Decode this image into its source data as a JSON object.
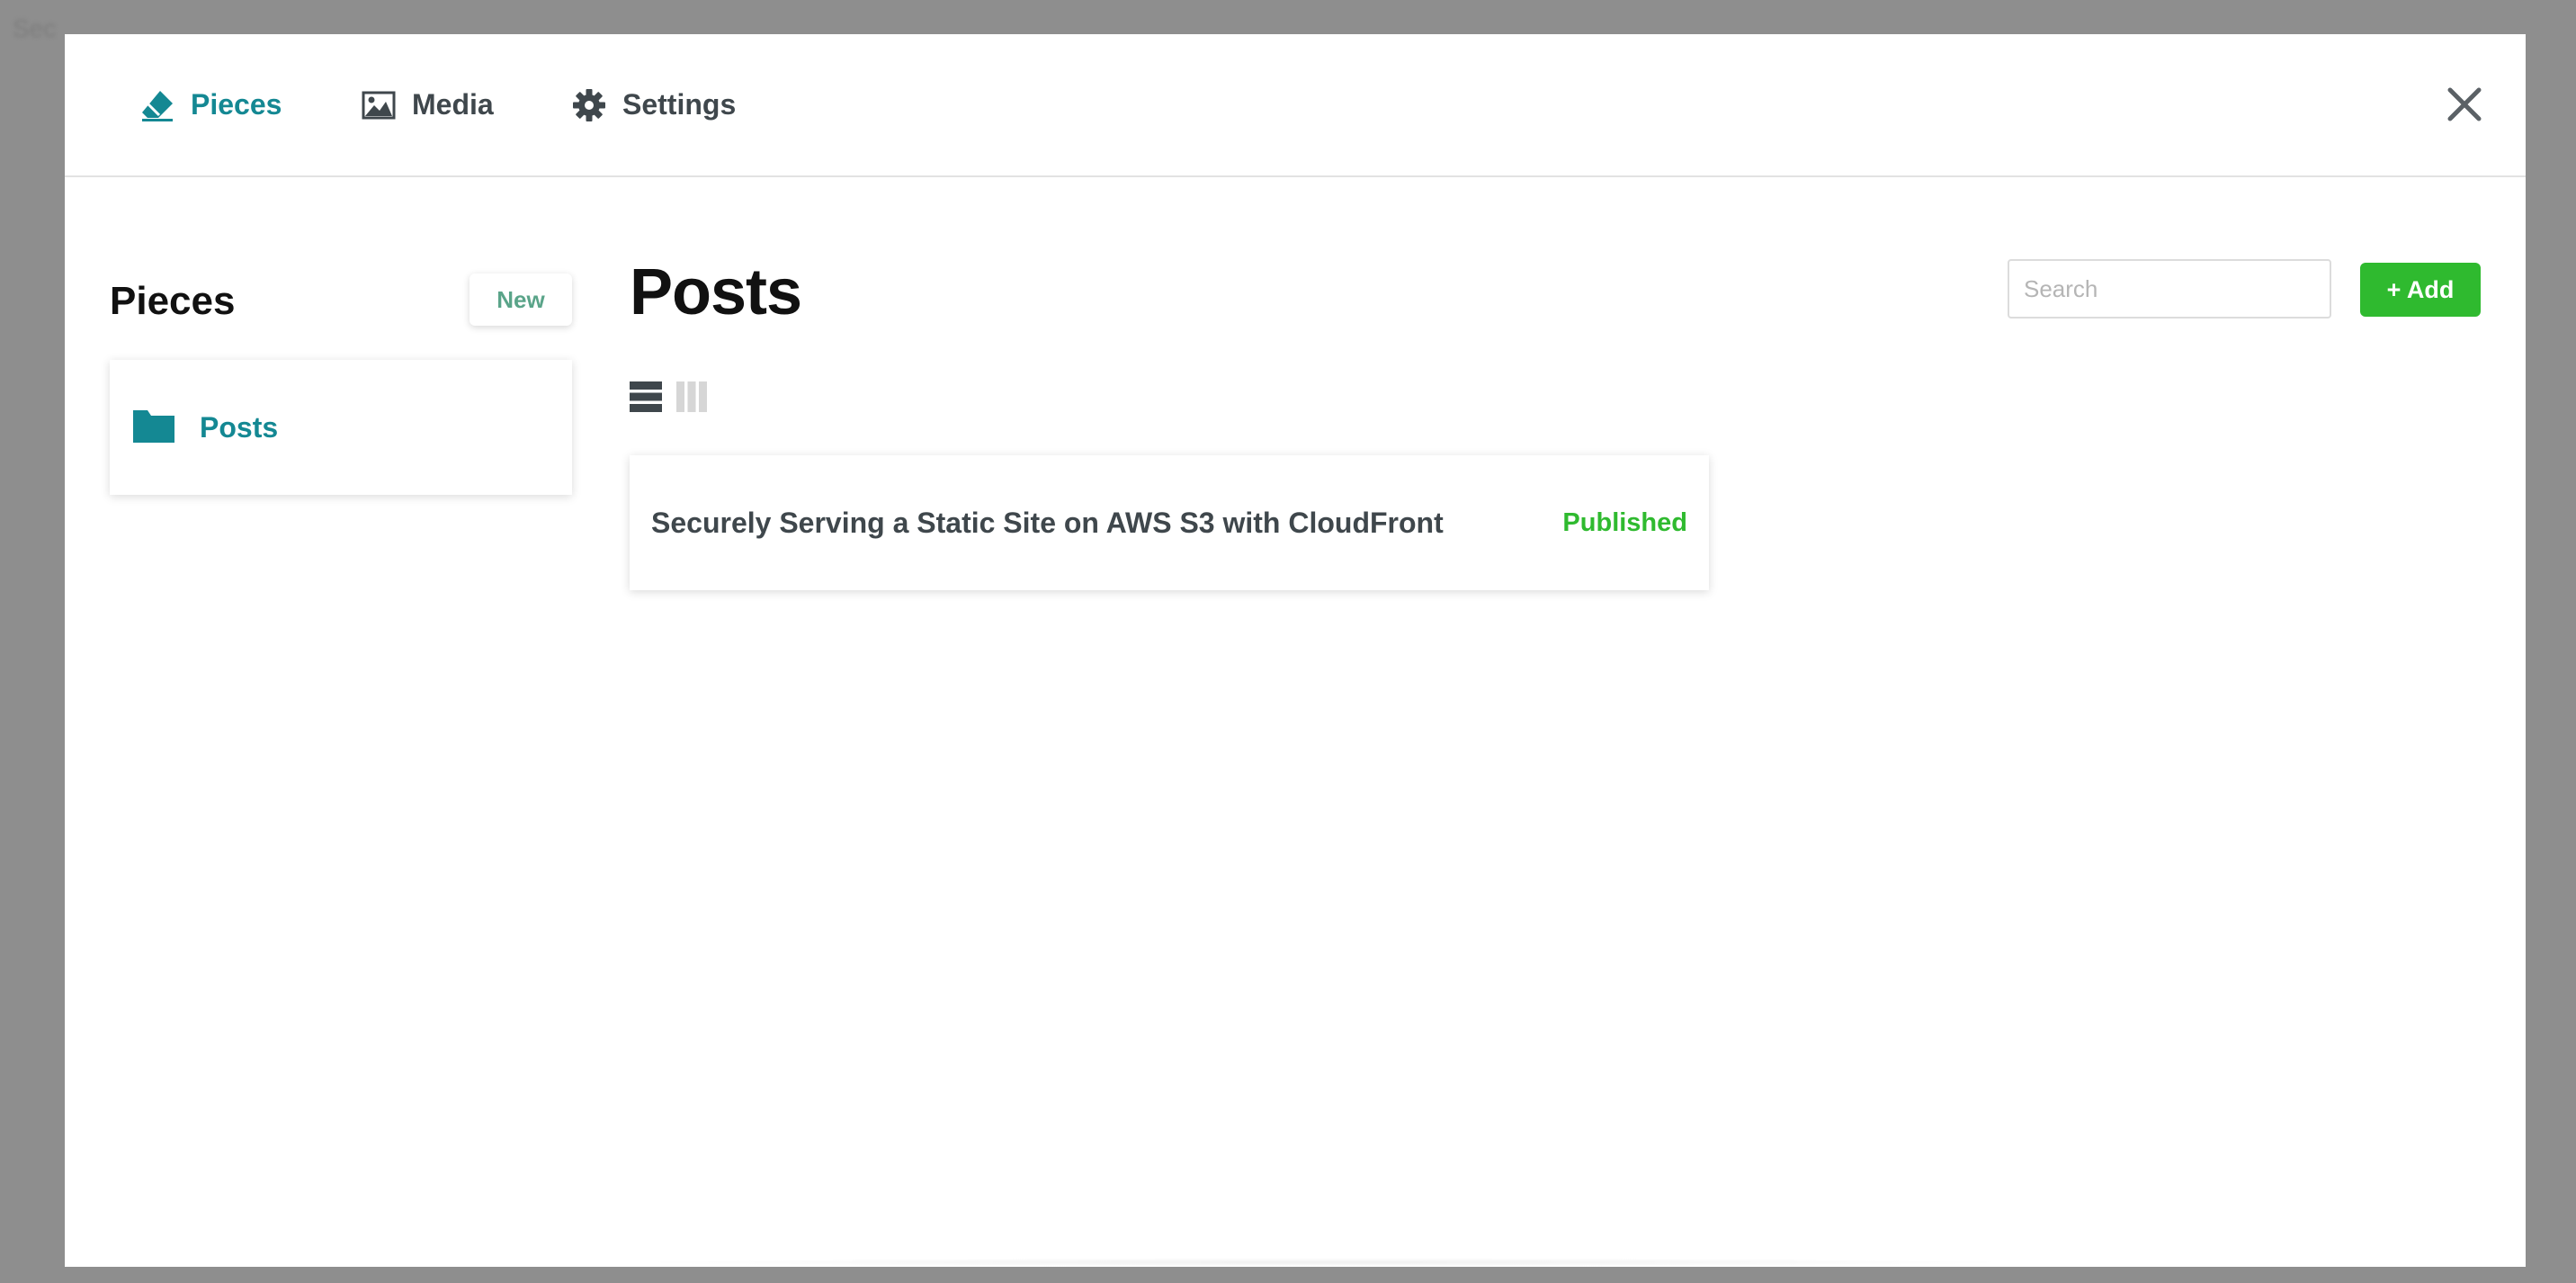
{
  "background": {
    "text": "Sec"
  },
  "nav": {
    "items": [
      {
        "label": "Pieces",
        "icon": "eraser-icon",
        "active": true
      },
      {
        "label": "Media",
        "icon": "image-icon",
        "active": false
      },
      {
        "label": "Settings",
        "icon": "gear-icon",
        "active": false
      }
    ],
    "close_icon": "close-icon"
  },
  "sidebar": {
    "title": "Pieces",
    "new_button_label": "New",
    "items": [
      {
        "label": "Posts",
        "icon": "folder-icon"
      }
    ]
  },
  "main": {
    "title": "Posts",
    "search": {
      "placeholder": "Search",
      "value": ""
    },
    "add_button_label": "+ Add",
    "view_modes": [
      {
        "icon": "list-view-icon",
        "active": true
      },
      {
        "icon": "column-view-icon",
        "active": false
      }
    ],
    "items": [
      {
        "title": "Securely Serving a Static Site on AWS S3 with CloudFront",
        "status": "Published"
      }
    ]
  },
  "colors": {
    "accent": "#148893",
    "nav_text": "#3f474c",
    "published": "#2fba2f",
    "add_button": "#2fba2f",
    "new_button_text": "#5aa489",
    "overlay": "#8e8e8e"
  }
}
